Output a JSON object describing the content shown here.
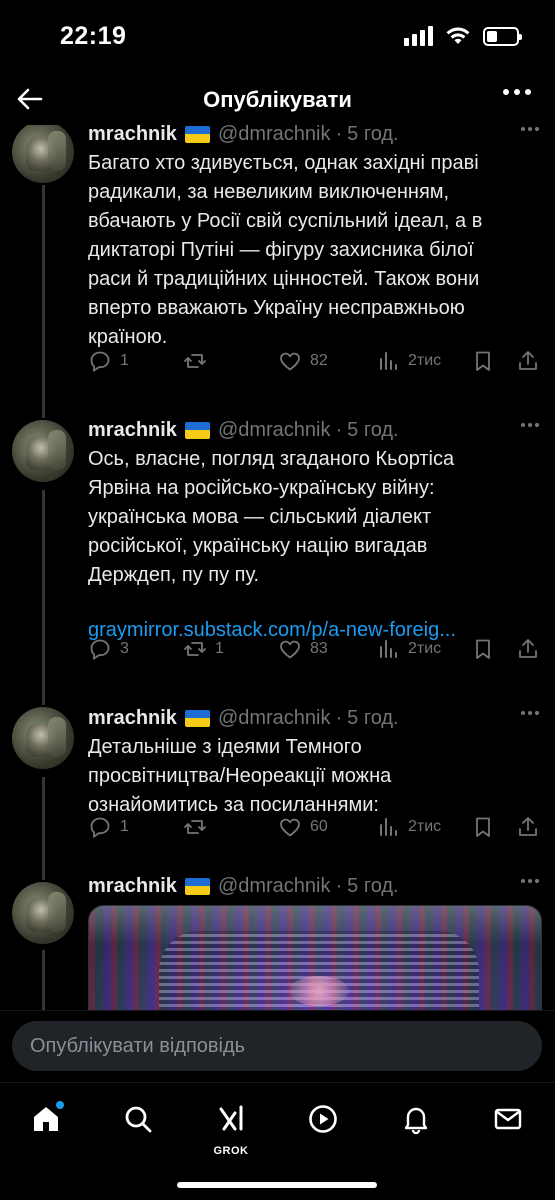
{
  "status_bar": {
    "time": "22:19",
    "battery_level": 0.35
  },
  "header": {
    "title": "Опублікувати",
    "back_icon": "arrow-left-icon",
    "more_icon": "more-horizontal-icon"
  },
  "tweets": [
    {
      "author": "mrachnik",
      "flag": "ukraine-flag",
      "handle": "@dmrachnik",
      "separator": "·",
      "time": "5 год.",
      "text": "Багато хто здивується, однак західні праві\nрадикали, за невеликим виключенням,\nвбачають у Росії свій суспільний ідеал, а в\nдиктаторі Путіні — фігуру захисника білої\nраси й традиційних цінностей. Також вони\nвперто вважають Україну несправжньою\nкраїною.",
      "link": "",
      "replies": "1",
      "retweets": "",
      "likes": "82",
      "views": "2тис"
    },
    {
      "author": "mrachnik",
      "flag": "ukraine-flag",
      "handle": "@dmrachnik",
      "separator": "·",
      "time": "5 год.",
      "text": "Ось, власне, погляд згаданого Кьортіса\nЯрвіна на російсько-українську війну:\nукраїнська мова — сільський діалект\nросійської, українську націю вигадав\nДерждеп, пу пу пу.",
      "link": "graymirror.substack.com/p/a-new-foreig...",
      "replies": "3",
      "retweets": "1",
      "likes": "83",
      "views": "2тис"
    },
    {
      "author": "mrachnik",
      "flag": "ukraine-flag",
      "handle": "@dmrachnik",
      "separator": "·",
      "time": "5 год.",
      "text": "Детальніше з ідеями Темного\nпросвітництва/Неореакції можна\nознайомитись за посиланнями:",
      "link": "",
      "replies": "1",
      "retweets": "",
      "likes": "60",
      "views": "2тис"
    },
    {
      "author": "mrachnik",
      "flag": "ukraine-flag",
      "handle": "@dmrachnik",
      "separator": "·",
      "time": "5 год.",
      "text": "",
      "link": "",
      "media": "glitch-portrait-image"
    }
  ],
  "reply": {
    "placeholder": "Опублікувати відповідь"
  },
  "tab_bar": {
    "items": [
      {
        "icon": "home-icon",
        "active": true,
        "notification": true
      },
      {
        "icon": "search-icon"
      },
      {
        "icon": "grok-icon",
        "label": "GROK"
      },
      {
        "icon": "play-circle-icon"
      },
      {
        "icon": "bell-icon"
      },
      {
        "icon": "mail-icon"
      }
    ]
  },
  "colors": {
    "background": "#000000",
    "text": "#e7e9ea",
    "muted": "#71767b",
    "link": "#1d9bf0",
    "input_bg": "#202327"
  }
}
